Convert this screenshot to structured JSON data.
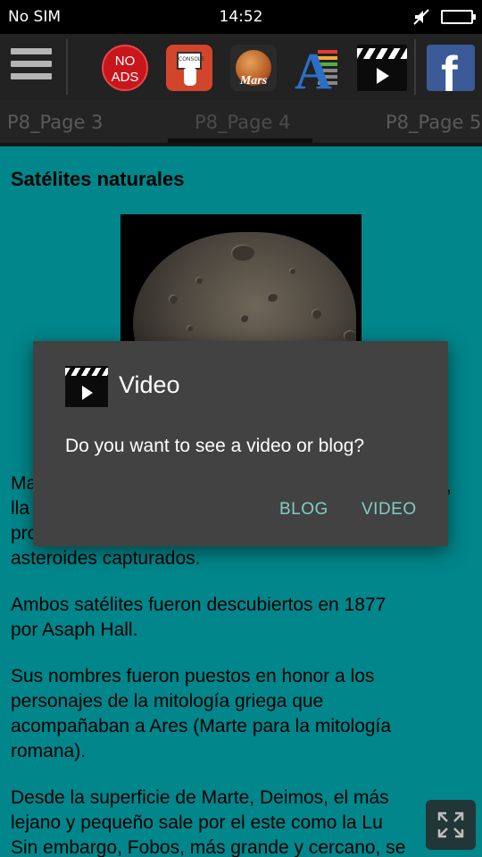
{
  "status_bar": {
    "carrier": "No SIM",
    "time": "14:52",
    "icons": [
      "mute-icon",
      "battery-icon"
    ]
  },
  "toolbar": {
    "menu_icon": "hamburger-menu-icon",
    "apps": [
      {
        "name": "no-ads",
        "label": "NO ADS",
        "color": "#c8161d"
      },
      {
        "name": "console",
        "label": "CONSOLE",
        "color": "#d2452a"
      },
      {
        "name": "mars",
        "label": "Mars",
        "color": "#2a2a2a"
      },
      {
        "name": "font",
        "label": "A",
        "color": "#2b6fc7"
      },
      {
        "name": "video",
        "label": "video-clapperboard-icon",
        "color": "#0b0b0b"
      },
      {
        "name": "facebook",
        "label": "f",
        "color": "#3b5a98"
      }
    ]
  },
  "tabs": [
    {
      "label": "P8_Page 3",
      "active": false
    },
    {
      "label": "P8_Page 4",
      "active": true
    },
    {
      "label": "P8_Page 5",
      "active": false
    }
  ],
  "content": {
    "heading": "Satélites naturales",
    "image": "moon-image",
    "paragraphs": [
      {
        "lines": [
          "Ma",
          "lla",
          "pro",
          "asteroides capturados."
        ]
      },
      {
        "lines": [
          "Ambos satélites fueron descubiertos en 1877",
          "por Asaph Hall."
        ]
      },
      {
        "lines": [
          "Sus nombres fueron puestos en honor a los",
          "personajes de la mitología griega que",
          "acompañaban a Ares (Marte para la mitología",
          "romana)."
        ]
      },
      {
        "lines": [
          "Desde la superficie de Marte, Deimos, el más",
          "lejano y pequeño sale por el este como la Lu",
          "Sin embargo, Fobos, más grande y cercano, se"
        ]
      }
    ],
    "partial_right_char": ","
  },
  "dialog": {
    "title": "Video",
    "message": "Do you want to see a video or blog?",
    "buttons": {
      "blog": "BLOG",
      "video": "VIDEO"
    },
    "accent_color": "#7fcfc4"
  },
  "fullscreen_button": "fullscreen-icon",
  "colors": {
    "background": "#00868b",
    "toolbar": "#222222",
    "dialog": "#424242"
  }
}
